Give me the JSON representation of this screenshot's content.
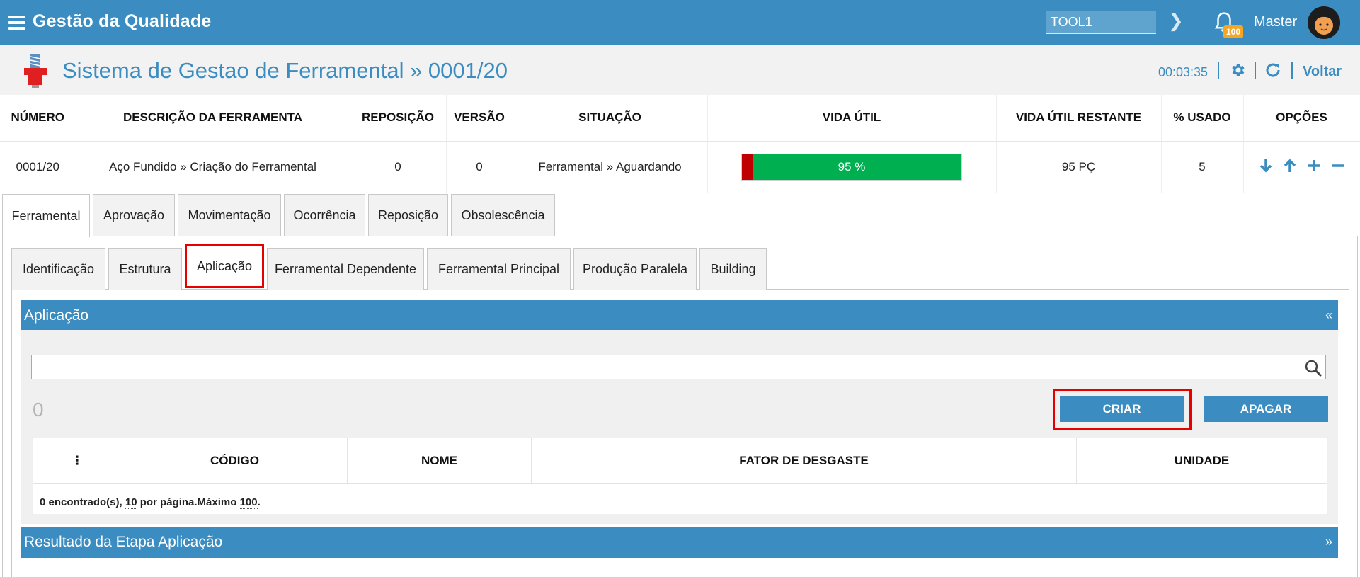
{
  "app": {
    "brand": "Gestão da Qualidade",
    "tool_value": "TOOL1",
    "notification_count": "100",
    "user_name": "Master"
  },
  "header": {
    "title": "Sistema de Gestao de Ferramental » 0001/20",
    "timer": "00:03:35",
    "back_label": "Voltar"
  },
  "summary": {
    "columns": [
      "NÚMERO",
      "DESCRIÇÃO DA FERRAMENTA",
      "REPOSIÇÃO",
      "VERSÃO",
      "SITUAÇÃO",
      "VIDA ÚTIL",
      "VIDA ÚTIL RESTANTE",
      "% USADO",
      "OPÇÕES"
    ],
    "row": {
      "numero": "0001/20",
      "descricao": "Aço Fundido » Criação do Ferramental",
      "reposicao": "0",
      "versao": "0",
      "situacao": "Ferramental » Aguardando",
      "vida_util_label": "95 %",
      "vida_util_percent": 95,
      "vida_restante": "95 PÇ",
      "usado": "5"
    }
  },
  "tabs_main": [
    "Ferramental",
    "Aprovação",
    "Movimentação",
    "Ocorrência",
    "Reposição",
    "Obsolescência"
  ],
  "tabs_sub": [
    "Identificação",
    "Estrutura",
    "Aplicação",
    "Ferramental Dependente",
    "Ferramental Principal",
    "Produção Paralela",
    "Building"
  ],
  "panel": {
    "title": "Aplicação",
    "collapse_glyph": "«",
    "count": "0",
    "create_label": "CRIAR",
    "delete_label": "APAGAR",
    "menu_glyph": "⋮",
    "columns": [
      "CÓDIGO",
      "NOME",
      "FATOR DE DESGASTE",
      "UNIDADE"
    ],
    "footer": {
      "found": "0 encontrado(s), ",
      "per_page": "10",
      "per_page_text": " por página.Máximo ",
      "max": "100",
      "end": "."
    }
  },
  "result_panel": {
    "title": "Resultado da Etapa Aplicação",
    "expand_glyph": "»"
  },
  "colors": {
    "primary": "#3a8cc1",
    "life_good": "#00b050",
    "life_bad": "#c00000",
    "highlight": "#e60000",
    "badge": "#f5a623"
  }
}
